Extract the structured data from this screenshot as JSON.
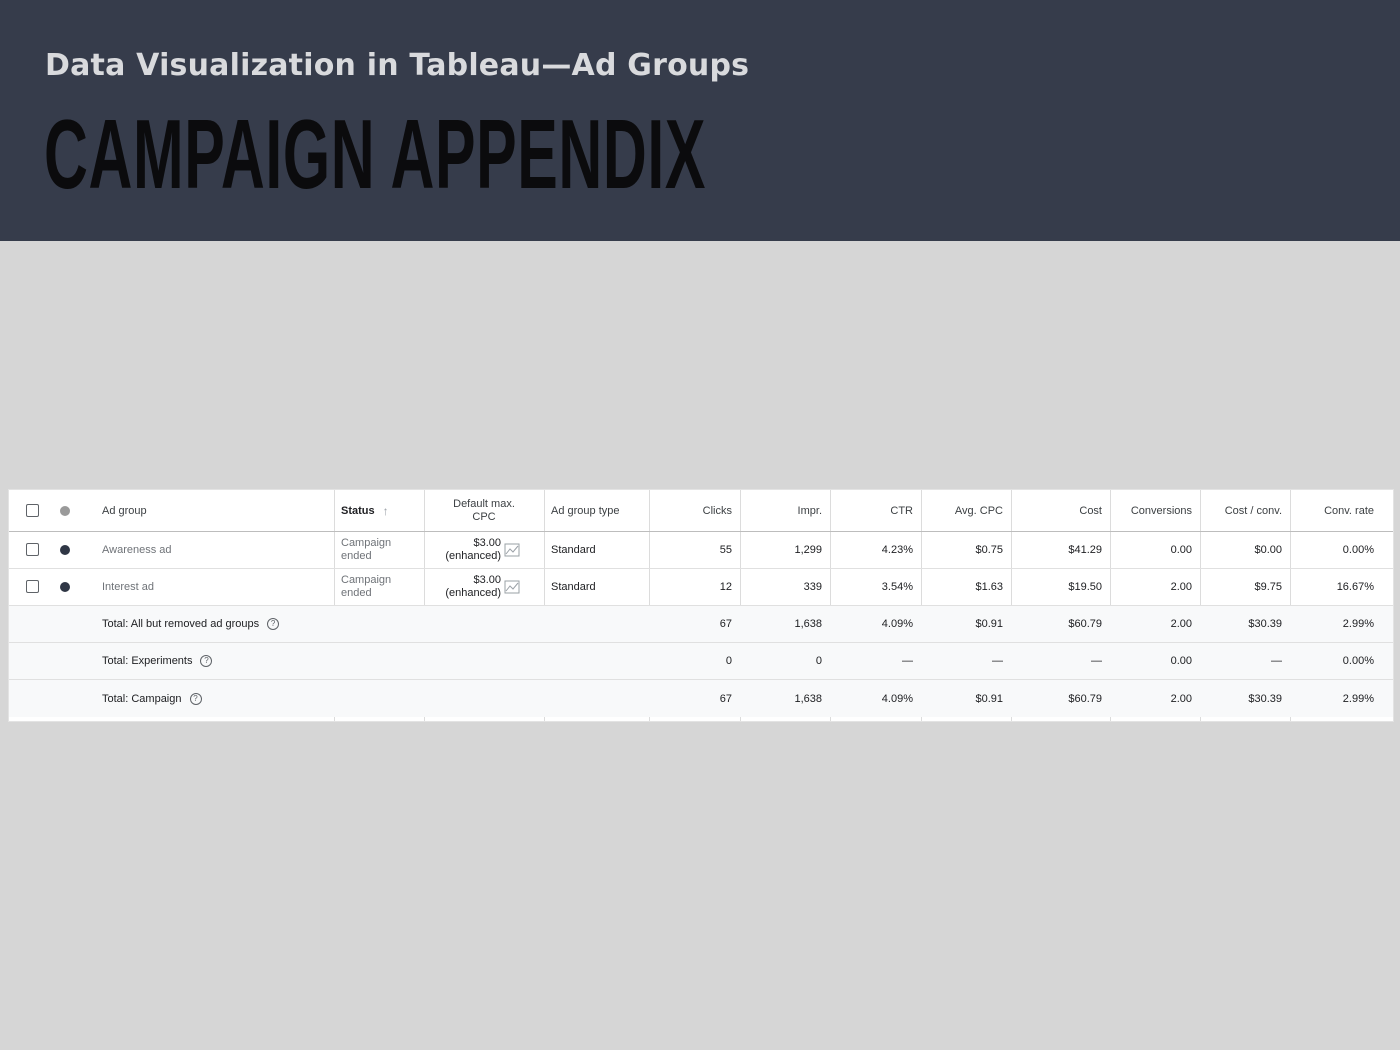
{
  "slide": {
    "subtitle": "Data Visualization in Tableau—Ad Groups",
    "title": "CAMPAIGN APPENDIX"
  },
  "table": {
    "headers": {
      "ad_group": "Ad group",
      "status": "Status",
      "default_max_cpc_line1": "Default max.",
      "default_max_cpc_line2": "CPC",
      "ad_group_type": "Ad group type",
      "clicks": "Clicks",
      "impr": "Impr.",
      "ctr": "CTR",
      "avg_cpc": "Avg. CPC",
      "cost": "Cost",
      "conversions": "Conversions",
      "cost_conv": "Cost / conv.",
      "conv_rate": "Conv. rate"
    },
    "rows": [
      {
        "ad_group": "Awareness ad",
        "status_line1": "Campaign",
        "status_line2": "ended",
        "cpc_line1": "$3.00",
        "cpc_line2": "(enhanced)",
        "type": "Standard",
        "clicks": "55",
        "impr": "1,299",
        "ctr": "4.23%",
        "avg_cpc": "$0.75",
        "cost": "$41.29",
        "conversions": "0.00",
        "cost_conv": "$0.00",
        "conv_rate": "0.00%"
      },
      {
        "ad_group": "Interest ad",
        "status_line1": "Campaign",
        "status_line2": "ended",
        "cpc_line1": "$3.00",
        "cpc_line2": "(enhanced)",
        "type": "Standard",
        "clicks": "12",
        "impr": "339",
        "ctr": "3.54%",
        "avg_cpc": "$1.63",
        "cost": "$19.50",
        "conversions": "2.00",
        "cost_conv": "$9.75",
        "conv_rate": "16.67%"
      }
    ],
    "totals": [
      {
        "label": "Total: All but removed ad groups",
        "clicks": "67",
        "impr": "1,638",
        "ctr": "4.09%",
        "avg_cpc": "$0.91",
        "cost": "$60.79",
        "conversions": "2.00",
        "cost_conv": "$30.39",
        "conv_rate": "2.99%"
      },
      {
        "label": "Total: Experiments",
        "clicks": "0",
        "impr": "0",
        "ctr": "—",
        "avg_cpc": "—",
        "cost": "—",
        "conversions": "0.00",
        "cost_conv": "—",
        "conv_rate": "0.00%"
      },
      {
        "label": "Total: Campaign",
        "clicks": "67",
        "impr": "1,638",
        "ctr": "4.09%",
        "avg_cpc": "$0.91",
        "cost": "$60.79",
        "conversions": "2.00",
        "cost_conv": "$30.39",
        "conv_rate": "2.99%"
      }
    ],
    "help_glyph": "?",
    "sort_glyph": "↑"
  }
}
